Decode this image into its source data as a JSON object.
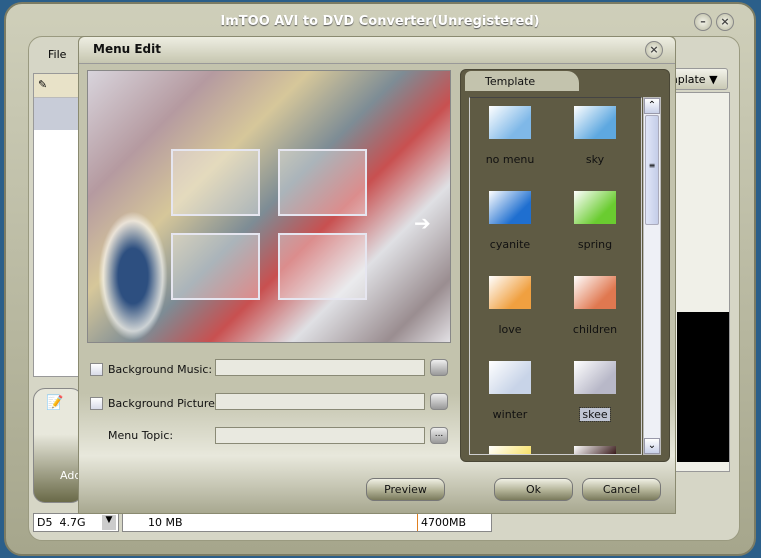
{
  "app": {
    "title": "ImTOO AVI to DVD Converter(Unregistered)",
    "menu": [
      "File"
    ],
    "template_dropdown": "mplate",
    "add_label": "Add"
  },
  "status": {
    "disc": "D5",
    "size": "4.7G",
    "used": "10 MB",
    "capacity": "4700MB"
  },
  "dialog": {
    "title": "Menu Edit",
    "background_music_label": "Background Music:",
    "background_picture_label": "Background Picture:",
    "menu_topic_label": "Menu Topic:",
    "background_music_checked": false,
    "background_picture_checked": false,
    "browse_label": "...",
    "preview_label": "Preview",
    "ok_label": "Ok",
    "cancel_label": "Cancel",
    "template_tab": "Template",
    "templates": [
      {
        "name": "no menu",
        "color": "#7fb8e8"
      },
      {
        "name": "sky",
        "color": "#5ea8e0"
      },
      {
        "name": "cyanite",
        "color": "#1f6fd0"
      },
      {
        "name": "spring",
        "color": "#6acc30"
      },
      {
        "name": "love",
        "color": "#f0a040"
      },
      {
        "name": "children",
        "color": "#e07850"
      },
      {
        "name": "winter",
        "color": "#c8d4e8"
      },
      {
        "name": "skee",
        "color": "#b8b8c8"
      },
      {
        "name": "",
        "color": "#f8e060"
      },
      {
        "name": "",
        "color": "#301010"
      }
    ],
    "selected_template": "skee"
  }
}
